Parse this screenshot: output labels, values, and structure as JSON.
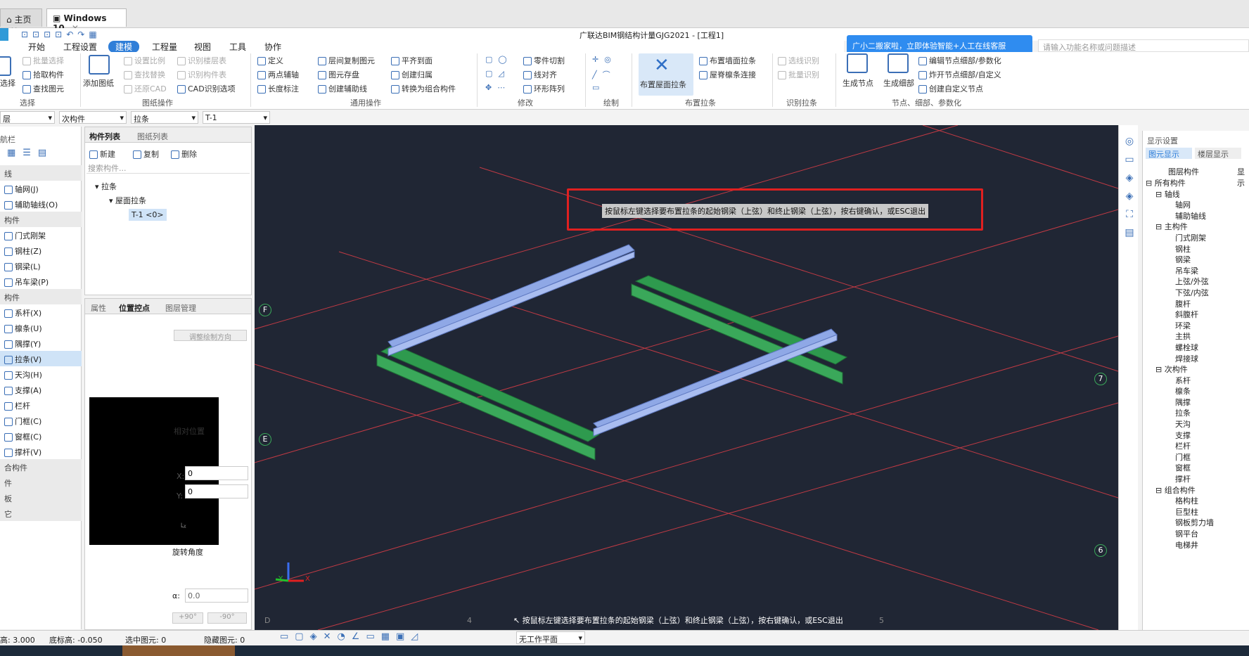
{
  "tabs": [
    {
      "label": "主页"
    },
    {
      "label": "Windows 10"
    }
  ],
  "window_title": "广联达BIM钢结构计量GJG2021 - [工程1]",
  "ribbon_tabs": [
    "开始",
    "工程设置",
    "建模",
    "工程量",
    "视图",
    "工具",
    "协作"
  ],
  "active_ribbon_tab": "建模",
  "ribbon": {
    "select": {
      "items": [
        "批量选择",
        "拾取构件",
        "查找图元"
      ],
      "big": "选择",
      "group": "选择"
    },
    "drawing": {
      "items": [
        "设置比例",
        "识别楼层表",
        "还原CAD",
        "CAD识别选项",
        "查找替换",
        "识别构件表"
      ],
      "big": "添加图纸",
      "group": "图纸操作"
    },
    "common": {
      "items": [
        "定义",
        "层间复制图元",
        "平齐到面",
        "两点辅轴",
        "图元存盘",
        "创建归属",
        "长度标注",
        "创建辅助线",
        "转换为组合构件"
      ],
      "group": "通用操作"
    },
    "modify": {
      "items": [
        "零件切割",
        "线对齐",
        "环形阵列"
      ],
      "group": "修改"
    },
    "draw": {
      "group": "绘制"
    },
    "layout": {
      "big": "布置屋面拉条",
      "items": [
        "布置墙面拉条",
        "屋脊檩条连接"
      ],
      "group": "布置拉条"
    },
    "recognize": {
      "items": [
        "选线识别",
        "批量识别"
      ],
      "group": "识别拉条"
    },
    "nodes": {
      "bigs": [
        "生成节点",
        "生成细部"
      ],
      "items": [
        "编辑节点细部/参数化",
        "炸开节点细部/自定义",
        "创建自定义节点"
      ],
      "group": "节点、细部、参数化"
    }
  },
  "banner": "广小二搬家啦，立即体验智能+人工在线客服",
  "search_placeholder": "请输入功能名称或问题描述",
  "selectors": [
    "层",
    "次构件",
    "拉条",
    "T-1"
  ],
  "left_nav": {
    "title": "航栏",
    "items": [
      {
        "label": "线",
        "sec": true
      },
      {
        "label": "轴网(J)"
      },
      {
        "label": "辅助轴线(O)"
      },
      {
        "label": "构件",
        "sec": true
      },
      {
        "label": "门式刚架"
      },
      {
        "label": "钢柱(Z)"
      },
      {
        "label": "钢梁(L)"
      },
      {
        "label": "吊车梁(P)"
      },
      {
        "label": "构件",
        "sec": true
      },
      {
        "label": "系杆(X)"
      },
      {
        "label": "檩条(U)"
      },
      {
        "label": "隅撑(Y)"
      },
      {
        "label": "拉条(V)",
        "sel": true
      },
      {
        "label": "天沟(H)"
      },
      {
        "label": "支撑(A)"
      },
      {
        "label": "栏杆"
      },
      {
        "label": "门框(C)"
      },
      {
        "label": "窗框(C)"
      },
      {
        "label": "撑杆(V)"
      },
      {
        "label": "合构件",
        "sec": true
      },
      {
        "label": "件",
        "sec": true
      },
      {
        "label": "板",
        "sec": true
      },
      {
        "label": "它",
        "sec": true
      }
    ]
  },
  "component_panel": {
    "tabs": [
      "构件列表",
      "图纸列表"
    ],
    "actions": [
      "新建",
      "复制",
      "删除"
    ],
    "search_placeholder": "搜索构件...",
    "tree": [
      "拉条",
      "屋面拉条",
      "T-1 <0>"
    ]
  },
  "property_panel": {
    "tabs": [
      "属性",
      "位置控点",
      "图层管理"
    ],
    "adjust_button": "调整绘制方向",
    "relative_position": "相对位置",
    "x_label": "X:",
    "x_value": "0",
    "y_label": "Y:",
    "y_value": "0",
    "rotation_label": "旋转角度",
    "alpha_label": "α:",
    "alpha_value": "0.0",
    "plus90": "+90°",
    "minus90": "-90°"
  },
  "canvas": {
    "prompt": "按鼠标左键选择要布置拉条的起始钢梁（上弦）和终止钢梁（上弦），按右键确认，或ESC退出",
    "axis_labels": [
      "F",
      "E",
      "D",
      "4",
      "5",
      "6",
      "7"
    ],
    "bottom_prompt": "按鼠标左键选择要布置拉条的起始钢梁（上弦）和终止钢梁（上弦），按右键确认，或ESC退出"
  },
  "right_panel": {
    "title": "显示设置",
    "tabs": [
      "图元显示",
      "楼层显示"
    ],
    "col_header": "图层构件",
    "col_header2": "显示",
    "tree": [
      {
        "label": "所有构件",
        "lvl": 0,
        "box": true
      },
      {
        "label": "轴线",
        "lvl": 1,
        "box": true
      },
      {
        "label": "轴网",
        "lvl": 2
      },
      {
        "label": "辅助轴线",
        "lvl": 2
      },
      {
        "label": "主构件",
        "lvl": 1,
        "box": true
      },
      {
        "label": "门式刚架",
        "lvl": 2
      },
      {
        "label": "钢柱",
        "lvl": 2
      },
      {
        "label": "钢梁",
        "lvl": 2
      },
      {
        "label": "吊车梁",
        "lvl": 2
      },
      {
        "label": "上弦/外弦",
        "lvl": 2
      },
      {
        "label": "下弦/内弦",
        "lvl": 2
      },
      {
        "label": "腹杆",
        "lvl": 2
      },
      {
        "label": "斜腹杆",
        "lvl": 2
      },
      {
        "label": "环梁",
        "lvl": 2
      },
      {
        "label": "主拱",
        "lvl": 2
      },
      {
        "label": "螺栓球",
        "lvl": 2
      },
      {
        "label": "焊接球",
        "lvl": 2
      },
      {
        "label": "次构件",
        "lvl": 1,
        "box": true
      },
      {
        "label": "系杆",
        "lvl": 2
      },
      {
        "label": "檩条",
        "lvl": 2
      },
      {
        "label": "隅撑",
        "lvl": 2
      },
      {
        "label": "拉条",
        "lvl": 2
      },
      {
        "label": "天沟",
        "lvl": 2
      },
      {
        "label": "支撑",
        "lvl": 2
      },
      {
        "label": "栏杆",
        "lvl": 2
      },
      {
        "label": "门框",
        "lvl": 2
      },
      {
        "label": "窗框",
        "lvl": 2
      },
      {
        "label": "撑杆",
        "lvl": 2
      },
      {
        "label": "组合构件",
        "lvl": 1,
        "box": true
      },
      {
        "label": "格构柱",
        "lvl": 2
      },
      {
        "label": "巨型柱",
        "lvl": 2
      },
      {
        "label": "钢板剪力墙",
        "lvl": 2
      },
      {
        "label": "钢平台",
        "lvl": 2
      },
      {
        "label": "电梯井",
        "lvl": 2
      }
    ]
  },
  "status": {
    "elevation": "高: 3.000",
    "bottom_elev": "底标高: -0.050",
    "selected": "选中图元: 0",
    "hidden": "隐藏图元: 0",
    "workplane": "无工作平面"
  },
  "colors": {
    "accent": "#2f7ed8",
    "canvas_bg": "#202634",
    "grid_line": "#c03a44",
    "beam_green": "#2e9a4e",
    "beam_blue": "#8fa8e6",
    "highlight_box": "#e02020"
  }
}
